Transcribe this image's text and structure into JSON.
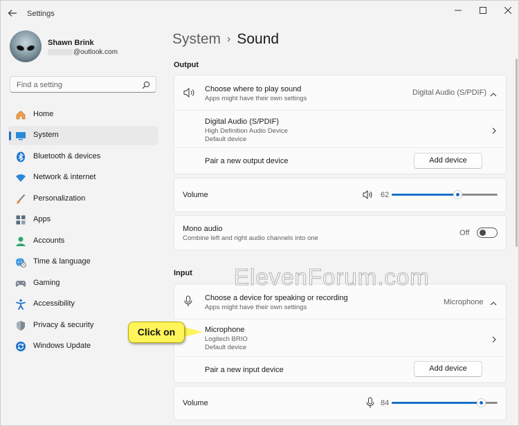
{
  "window": {
    "title": "Settings",
    "minimize_icon": "minimize-icon",
    "maximize_icon": "maximize-icon",
    "close_icon": "close-icon"
  },
  "user": {
    "name": "Shawn Brink",
    "email": "@outlook.com"
  },
  "search": {
    "placeholder": "Find a setting"
  },
  "sidebar": {
    "items": [
      {
        "label": "Home",
        "icon": "home-icon"
      },
      {
        "label": "System",
        "icon": "system-icon",
        "selected": true
      },
      {
        "label": "Bluetooth & devices",
        "icon": "bluetooth-icon"
      },
      {
        "label": "Network & internet",
        "icon": "wifi-icon"
      },
      {
        "label": "Personalization",
        "icon": "brush-icon"
      },
      {
        "label": "Apps",
        "icon": "apps-icon"
      },
      {
        "label": "Accounts",
        "icon": "accounts-icon"
      },
      {
        "label": "Time & language",
        "icon": "globe-clock-icon"
      },
      {
        "label": "Gaming",
        "icon": "gamepad-icon"
      },
      {
        "label": "Accessibility",
        "icon": "accessibility-icon"
      },
      {
        "label": "Privacy & security",
        "icon": "shield-icon"
      },
      {
        "label": "Windows Update",
        "icon": "update-icon"
      }
    ]
  },
  "breadcrumb": {
    "parent": "System",
    "separator": "›",
    "current": "Sound"
  },
  "output": {
    "section_label": "Output",
    "choose": {
      "title": "Choose where to play sound",
      "subtitle": "Apps might have their own settings",
      "value": "Digital Audio (S/PDIF)"
    },
    "device": {
      "name": "Digital Audio (S/PDIF)",
      "line1": "High Definition Audio Device",
      "line2": "Default device"
    },
    "pair": {
      "label": "Pair a new output device",
      "button": "Add device"
    },
    "volume": {
      "label": "Volume",
      "value": "62",
      "level": 62
    },
    "mono": {
      "title": "Mono audio",
      "subtitle": "Combine left and right audio channels into one",
      "state": "Off"
    }
  },
  "input": {
    "section_label": "Input",
    "choose": {
      "title": "Choose a device for speaking or recording",
      "subtitle": "Apps might have their own settings",
      "value": "Microphone"
    },
    "device": {
      "name": "Microphone",
      "line1": "Logitech BRIO",
      "line2": "Default device"
    },
    "pair": {
      "label": "Pair a new input device",
      "button": "Add device"
    },
    "volume": {
      "label": "Volume",
      "value": "84",
      "level": 84
    }
  },
  "watermark": "ElevenForum.com",
  "callout": "Click on",
  "colors": {
    "accent": "#1a6fc8",
    "callout": "#fff45a"
  }
}
